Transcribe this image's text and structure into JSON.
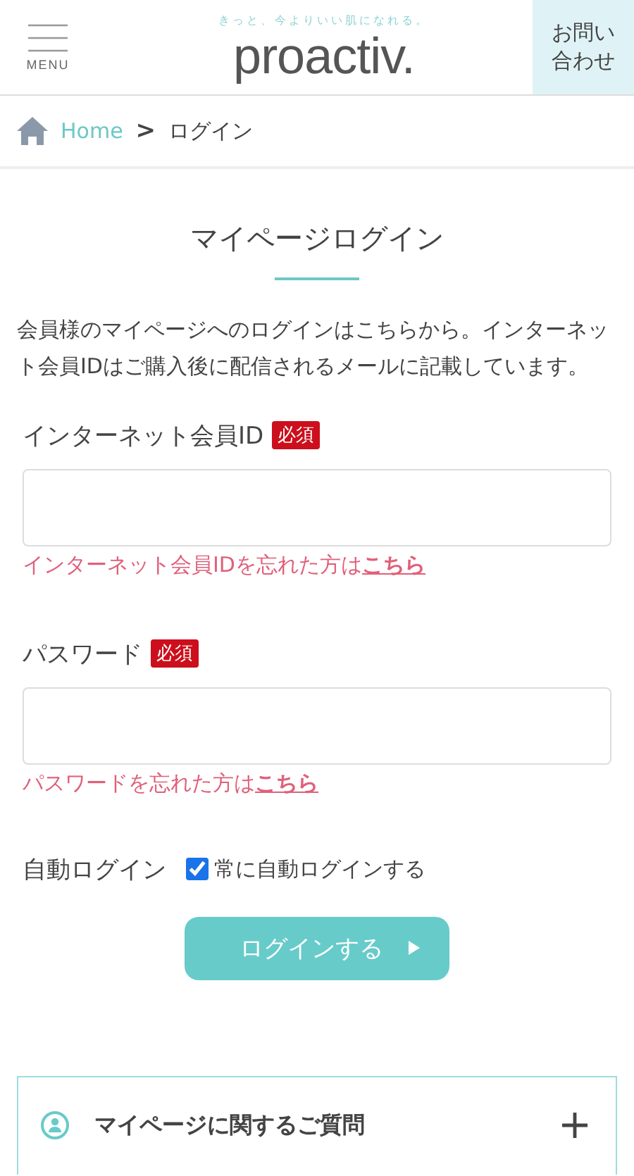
{
  "header": {
    "menu_label": "MENU",
    "tagline": "きっと、今よりいい肌になれる。",
    "logo": "proactiv.",
    "contact_button": "お問い合わせ"
  },
  "breadcrumb": [
    {
      "label": "Home",
      "kind": "home"
    },
    {
      "label": "ログイン",
      "kind": "current"
    }
  ],
  "breadcrumb_separator": ">",
  "page_title": "マイページログイン",
  "intro": "会員様のマイページへのログインはこちらから。インターネット会員IDはご購入後に配信されるメールに記載しています。",
  "fields": [
    {
      "label": "インターネット会員ID",
      "required_badge": "必須",
      "forgot_text": "インターネット会員IDを忘れた方は",
      "forgot_link": "こちら"
    },
    {
      "label": "パスワード",
      "required_badge": "必須",
      "forgot_text": "パスワードを忘れた方は",
      "forgot_link": "こちら"
    }
  ],
  "auto_login": {
    "label": "自動ログイン",
    "option": "常に自動ログインする",
    "checked": true
  },
  "submit_button": "ログインする",
  "faq": [
    {
      "title": "マイページに関するご質問",
      "expanded": false
    }
  ]
}
